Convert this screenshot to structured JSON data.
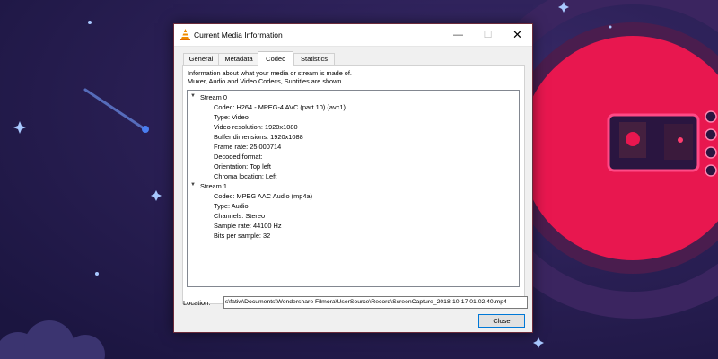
{
  "window": {
    "title": "Current Media Information",
    "controls": {
      "minimize": "—",
      "maximize": "☐",
      "close": "✕"
    }
  },
  "tabs": [
    {
      "label": "General",
      "active": false
    },
    {
      "label": "Metadata",
      "active": false
    },
    {
      "label": "Codec",
      "active": true
    },
    {
      "label": "Statistics",
      "active": false
    }
  ],
  "codec_panel": {
    "description_line1": "Information about what your media or stream is made of.",
    "description_line2": "Muxer, Audio and Video Codecs, Subtitles are shown.",
    "streams": [
      {
        "label": "Stream 0",
        "expanded": true,
        "fields": [
          "Codec: H264 - MPEG-4 AVC (part 10) (avc1)",
          "Type: Video",
          "Video resolution: 1920x1080",
          "Buffer dimensions: 1920x1088",
          "Frame rate: 25.000714",
          "Decoded format:",
          "Orientation: Top left",
          "Chroma location: Left"
        ]
      },
      {
        "label": "Stream 1",
        "expanded": true,
        "fields": [
          "Codec: MPEG AAC Audio (mp4a)",
          "Type: Audio",
          "Channels: Stereo",
          "Sample rate: 44100 Hz",
          "Bits per sample: 32"
        ]
      }
    ]
  },
  "location": {
    "label": "Location:",
    "value": "s\\fatiw\\Documents\\Wondershare Filmora\\UserSource\\Record\\ScreenCapture_2018-10-17 01.02.40.mp4"
  },
  "buttons": {
    "close": "Close"
  },
  "colors": {
    "wallpaper_bg": "#2a1f52",
    "planet": "#e8174f",
    "accent_button_border": "#0078d7",
    "vlc_orange": "#f08c00"
  },
  "icons": {
    "app": "vlc-cone-icon",
    "tree_expand": "chevron-down-icon"
  }
}
